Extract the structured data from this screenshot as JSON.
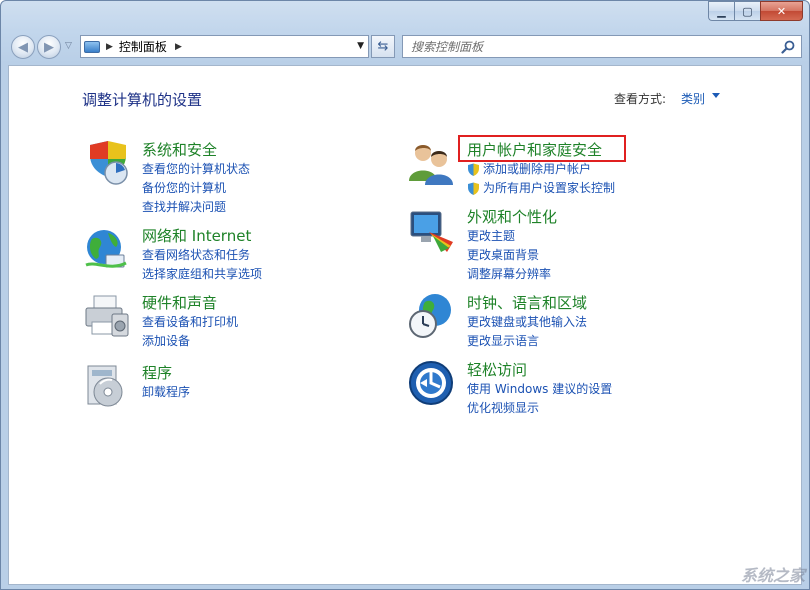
{
  "address_bar": {
    "path": "控制面板"
  },
  "search": {
    "placeholder": "搜索控制面板"
  },
  "header": {
    "title": "调整计算机的设置",
    "view_by_label": "查看方式:",
    "view_by_value": "类别"
  },
  "categories_left": [
    {
      "title": "系统和安全",
      "links": [
        "查看您的计算机状态",
        "备份您的计算机",
        "查找并解决问题"
      ]
    },
    {
      "title": "网络和 Internet",
      "links": [
        "查看网络状态和任务",
        "选择家庭组和共享选项"
      ]
    },
    {
      "title": "硬件和声音",
      "links": [
        "查看设备和打印机",
        "添加设备"
      ]
    },
    {
      "title": "程序",
      "links": [
        "卸载程序"
      ]
    }
  ],
  "categories_right": [
    {
      "title": "用户帐户和家庭安全",
      "links": [
        "添加或删除用户帐户",
        "为所有用户设置家长控制"
      ]
    },
    {
      "title": "外观和个性化",
      "links": [
        "更改主题",
        "更改桌面背景",
        "调整屏幕分辨率"
      ]
    },
    {
      "title": "时钟、语言和区域",
      "links": [
        "更改键盘或其他输入法",
        "更改显示语言"
      ]
    },
    {
      "title": "轻松访问",
      "links": [
        "使用 Windows 建议的设置",
        "优化视频显示"
      ]
    }
  ],
  "colors": {
    "category_title": "#1e8228",
    "link": "#1c52b3",
    "highlight": "#e02020"
  },
  "watermark": "系统之家"
}
